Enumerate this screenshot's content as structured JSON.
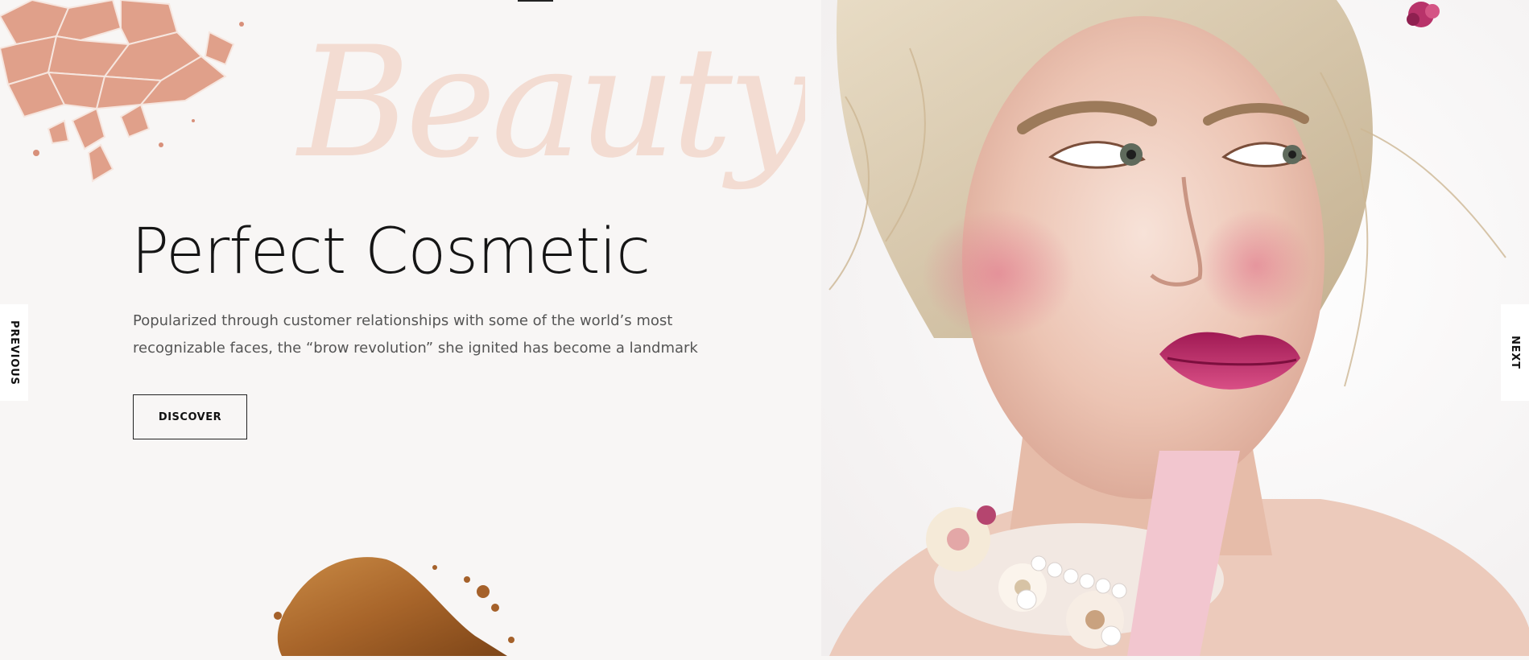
{
  "hero": {
    "script_word": "Beauty",
    "title": "Perfect Cosmetic",
    "description": "Popularized through customer relationships with some of the world’s most recognizable faces, the “brow revolution” she ignited has become a landmark",
    "cta_label": "DISCOVER"
  },
  "slider": {
    "prev_label": "PREVIOUS",
    "next_label": "NEXT"
  },
  "colors": {
    "background": "#f8f6f5",
    "script_accent": "#f3dcd2",
    "powder_pink": "#e0a08a",
    "bronzer": "#b0722f"
  },
  "icons": [
    "crushed-powder-image",
    "bronzer-swatch-image",
    "model-portrait-image"
  ]
}
